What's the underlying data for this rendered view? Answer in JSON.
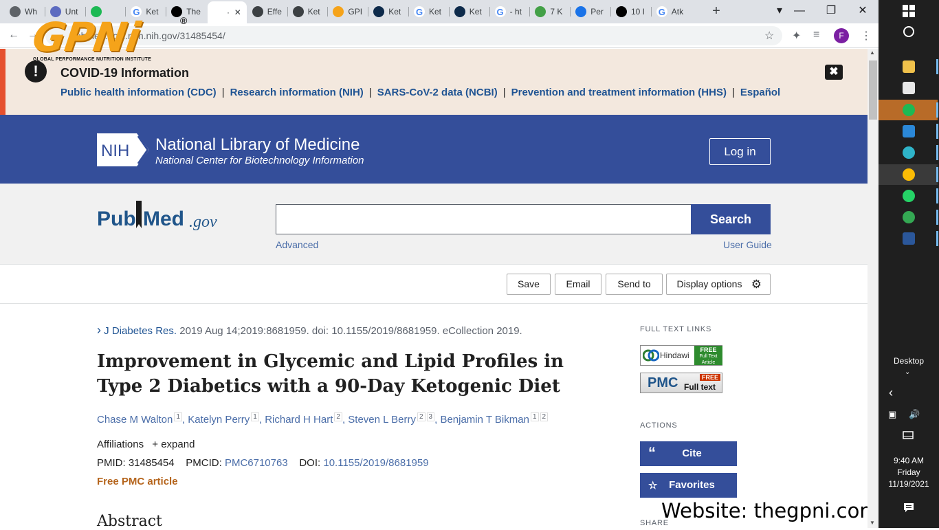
{
  "browser": {
    "tabs": [
      {
        "label": "Wh",
        "fav_color": "#5f6368",
        "icon": "chrome-icon"
      },
      {
        "label": "Unt",
        "fav_color": "#5c6bc0",
        "icon": "docs-icon"
      },
      {
        "label": "",
        "fav_color": "#1db954",
        "icon": "spotify-icon"
      },
      {
        "label": "Ket",
        "fav_color": "#4285f4",
        "icon": "google-icon"
      },
      {
        "label": "The",
        "fav_color": "#000000",
        "icon": "site-icon"
      },
      {
        "label": "·",
        "fav_color": "#ffffff",
        "icon": "loading-icon",
        "active": true
      },
      {
        "label": "Effe",
        "fav_color": "#3c4043",
        "icon": "link-icon"
      },
      {
        "label": "Ket",
        "fav_color": "#3c4043",
        "icon": "link-icon"
      },
      {
        "label": "GPI",
        "fav_color": "#f5a31a",
        "icon": "gpni-icon"
      },
      {
        "label": "Ket",
        "fav_color": "#0d2a4a",
        "icon": "site-icon"
      },
      {
        "label": "Ket",
        "fav_color": "#4285f4",
        "icon": "google-icon"
      },
      {
        "label": "Ket",
        "fav_color": "#0d2a4a",
        "icon": "site-icon"
      },
      {
        "label": "- ht",
        "fav_color": "#4285f4",
        "icon": "google-icon"
      },
      {
        "label": "7 K",
        "fav_color": "#43a047",
        "icon": "site-icon"
      },
      {
        "label": "Per",
        "fav_color": "#1a73e8",
        "icon": "link-icon"
      },
      {
        "label": "10 I",
        "fav_color": "#000000",
        "icon": "site-icon"
      },
      {
        "label": "Atk",
        "fav_color": "#4285f4",
        "icon": "google-icon"
      }
    ],
    "new_tab_symbol": "+",
    "window_controls": {
      "minimize": "—",
      "restore": "❐",
      "close": "✕"
    },
    "url": "pubmed.ncbi.nlm.nih.gov/31485454/",
    "profile_initial": "F"
  },
  "watermark": {
    "logo_text": "GPNi",
    "registered": "®",
    "subtitle": "GLOBAL PERFORMANCE NUTRITION INSTITUTE",
    "website": "Website: thegpni.com"
  },
  "covid_banner": {
    "icon": "!",
    "title": "COVID-19 Information",
    "links": [
      "Public health information (CDC)",
      "Research information (NIH)",
      "SARS-CoV-2 data (NCBI)",
      "Prevention and treatment information (HHS)",
      "Español"
    ],
    "separator": "|",
    "close_symbol": "✖"
  },
  "nih_header": {
    "badge": "NIH",
    "title": "National Library of Medicine",
    "subtitle": "National Center for Biotechnology Information",
    "login_label": "Log in"
  },
  "search": {
    "logo_pub": "Pub",
    "logo_med": "Med",
    "logo_gov": ".gov",
    "placeholder": "",
    "button_label": "Search",
    "advanced_label": "Advanced",
    "user_guide_label": "User Guide"
  },
  "actions_bar": {
    "save": "Save",
    "email": "Email",
    "send_to": "Send to",
    "display_options": "Display options"
  },
  "article": {
    "citation_arrow": "›",
    "journal": "J Diabetes Res.",
    "citation_rest": "2019 Aug 14;2019:8681959. doi: 10.1155/2019/8681959. eCollection 2019.",
    "title": "Improvement in Glycemic and Lipid Profiles in Type 2 Diabetics with a 90-Day Ketogenic Diet",
    "authors": [
      {
        "name": "Chase M Walton",
        "sups": [
          "1"
        ]
      },
      {
        "name": "Katelyn Perry",
        "sups": [
          "1"
        ]
      },
      {
        "name": "Richard H Hart",
        "sups": [
          "2"
        ]
      },
      {
        "name": "Steven L Berry",
        "sups": [
          "2",
          "3"
        ]
      },
      {
        "name": "Benjamin T Bikman",
        "sups": [
          "1",
          "2"
        ]
      }
    ],
    "affiliations_label": "Affiliations",
    "expand_label": "expand",
    "pmid_label": "PMID:",
    "pmid": "31485454",
    "pmcid_label": "PMCID:",
    "pmcid": "PMC6710763",
    "doi_label": "DOI:",
    "doi": "10.1155/2019/8681959",
    "free_pmc": "Free PMC article",
    "abstract_heading": "Abstract"
  },
  "sidebar": {
    "full_text_links_heading": "FULL TEXT LINKS",
    "hindawi_label": "Hindawi",
    "hindawi_badge": "FREE",
    "hindawi_badge_sub": "Full Text Article",
    "pmc_label": "PMC",
    "pmc_badge": "FREE",
    "pmc_sub": "Full text",
    "actions_heading": "ACTIONS",
    "cite_icon": "“",
    "cite_label": "Cite",
    "favorites_icon": "☆",
    "favorites_label": "Favorites",
    "share_heading": "SHARE"
  },
  "taskbar": {
    "desktop_label": "Desktop",
    "clock_time": "9:40 AM",
    "clock_day": "Friday",
    "clock_date": "11/19/2021",
    "apps": [
      {
        "name": "file-explorer-icon",
        "color": "#f0c14b"
      },
      {
        "name": "store-icon",
        "color": "#e8e8e8"
      },
      {
        "name": "spotify-icon",
        "color": "#1db954"
      },
      {
        "name": "mail-icon",
        "color": "#2b88d8"
      },
      {
        "name": "edge-icon",
        "color": "#2fb4c9"
      },
      {
        "name": "chrome-icon",
        "color": "#fbbc05"
      },
      {
        "name": "whatsapp-icon",
        "color": "#25d366"
      },
      {
        "name": "chrome-icon",
        "color": "#34a853"
      },
      {
        "name": "word-icon",
        "color": "#2b579a"
      }
    ]
  }
}
